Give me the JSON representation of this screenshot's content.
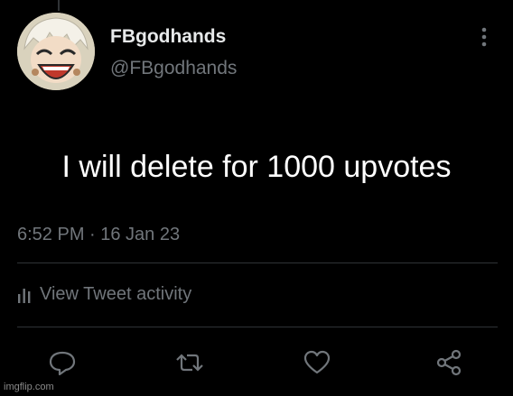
{
  "author": {
    "display_name": "FBgodhands",
    "handle": "@FBgodhands",
    "avatar_icon": "cartoon-avatar-icon"
  },
  "tweet": {
    "text": "I will delete for 1000 upvotes",
    "timestamp": "6:52 PM · 16 Jan 23"
  },
  "activity": {
    "label": "View Tweet activity",
    "icon": "bar-chart-icon"
  },
  "actions": [
    {
      "name": "reply",
      "icon": "reply-icon"
    },
    {
      "name": "retweet",
      "icon": "retweet-icon"
    },
    {
      "name": "like",
      "icon": "heart-icon"
    },
    {
      "name": "share",
      "icon": "share-icon"
    }
  ],
  "watermark": "imgflip.com",
  "colors": {
    "background": "#000000",
    "primary_text": "#e7e9ea",
    "secondary_text": "#71767b",
    "divider": "#2f3336"
  }
}
